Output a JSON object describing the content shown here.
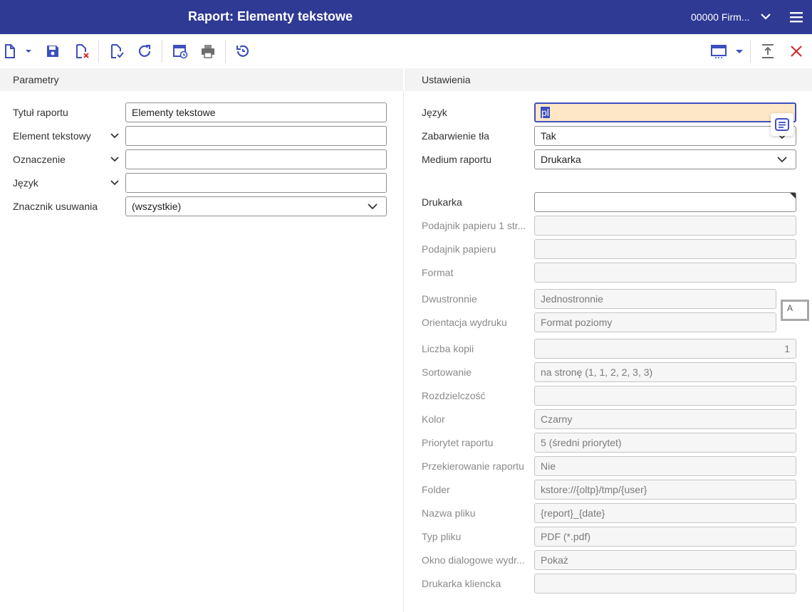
{
  "header": {
    "title": "Raport: Elementy tekstowe",
    "company": "00000  Firm..."
  },
  "toolbar": {
    "icons": [
      "new-document-icon",
      "dropdown-arrow-icon",
      "save-icon",
      "discard-icon",
      "validate-icon",
      "refresh-icon",
      "schedule-icon",
      "print-icon",
      "history-icon",
      "layout-icon",
      "layout-dropdown-icon",
      "collapse-icon",
      "close-icon"
    ],
    "accent": "#2e3a94",
    "close_color": "#d32f2f"
  },
  "left": {
    "section": "Parametry",
    "title_label": "Tytuł raportu",
    "title_value": "Elementy tekstowe",
    "element_label": "Element tekstowy",
    "element_value": "",
    "oznaczenie_label": "Oznaczenie",
    "oznaczenie_value": "",
    "jezyk_label": "Język",
    "jezyk_value": "",
    "znacznik_label": "Znacznik usuwania",
    "znacznik_value": "(wszystkie)"
  },
  "right": {
    "section": "Ustawienia",
    "jezyk_label": "Język",
    "jezyk_value": "pl",
    "zabarwienie_label": "Zabarwienie tła",
    "zabarwienie_value": "Tak",
    "medium_label": "Medium raportu",
    "medium_value": "Drukarka",
    "drukarka_label": "Drukarka",
    "drukarka_value": "",
    "podajnik1_label": "Podajnik papieru 1 str...",
    "podajnik1_value": "",
    "podajnik_label": "Podajnik papieru",
    "podajnik_value": "",
    "format_label": "Format",
    "format_value": "",
    "dwustronnie_label": "Dwustronnie",
    "dwustronnie_value": "Jednostronnie",
    "orientacja_label": "Orientacja wydruku",
    "orientacja_value": "Format poziomy",
    "kopie_label": "Liczba kopii",
    "kopie_value": "1",
    "sortowanie_label": "Sortowanie",
    "sortowanie_value": "na stronę (1, 1, 2, 2, 3, 3)",
    "rozdzielczosc_label": "Rozdzielczość",
    "rozdzielczosc_value": "",
    "kolor_label": "Kolor",
    "kolor_value": "Czarny",
    "priorytet_label": "Priorytet raportu",
    "priorytet_value": "5 (średni priorytet)",
    "przekierowanie_label": "Przekierowanie raportu",
    "przekierowanie_value": "Nie",
    "folder_label": "Folder",
    "folder_value": "kstore://{oltp}/tmp/{user}",
    "nazwa_label": "Nazwa pliku",
    "nazwa_value": "{report}_{date}",
    "typ_label": "Typ pliku",
    "typ_value": "PDF (*.pdf)",
    "okno_label": "Okno dialogowe wydr...",
    "okno_value": "Pokaż",
    "kliencka_label": "Drukarka kliencka",
    "kliencka_value": "",
    "a_box": "A"
  }
}
